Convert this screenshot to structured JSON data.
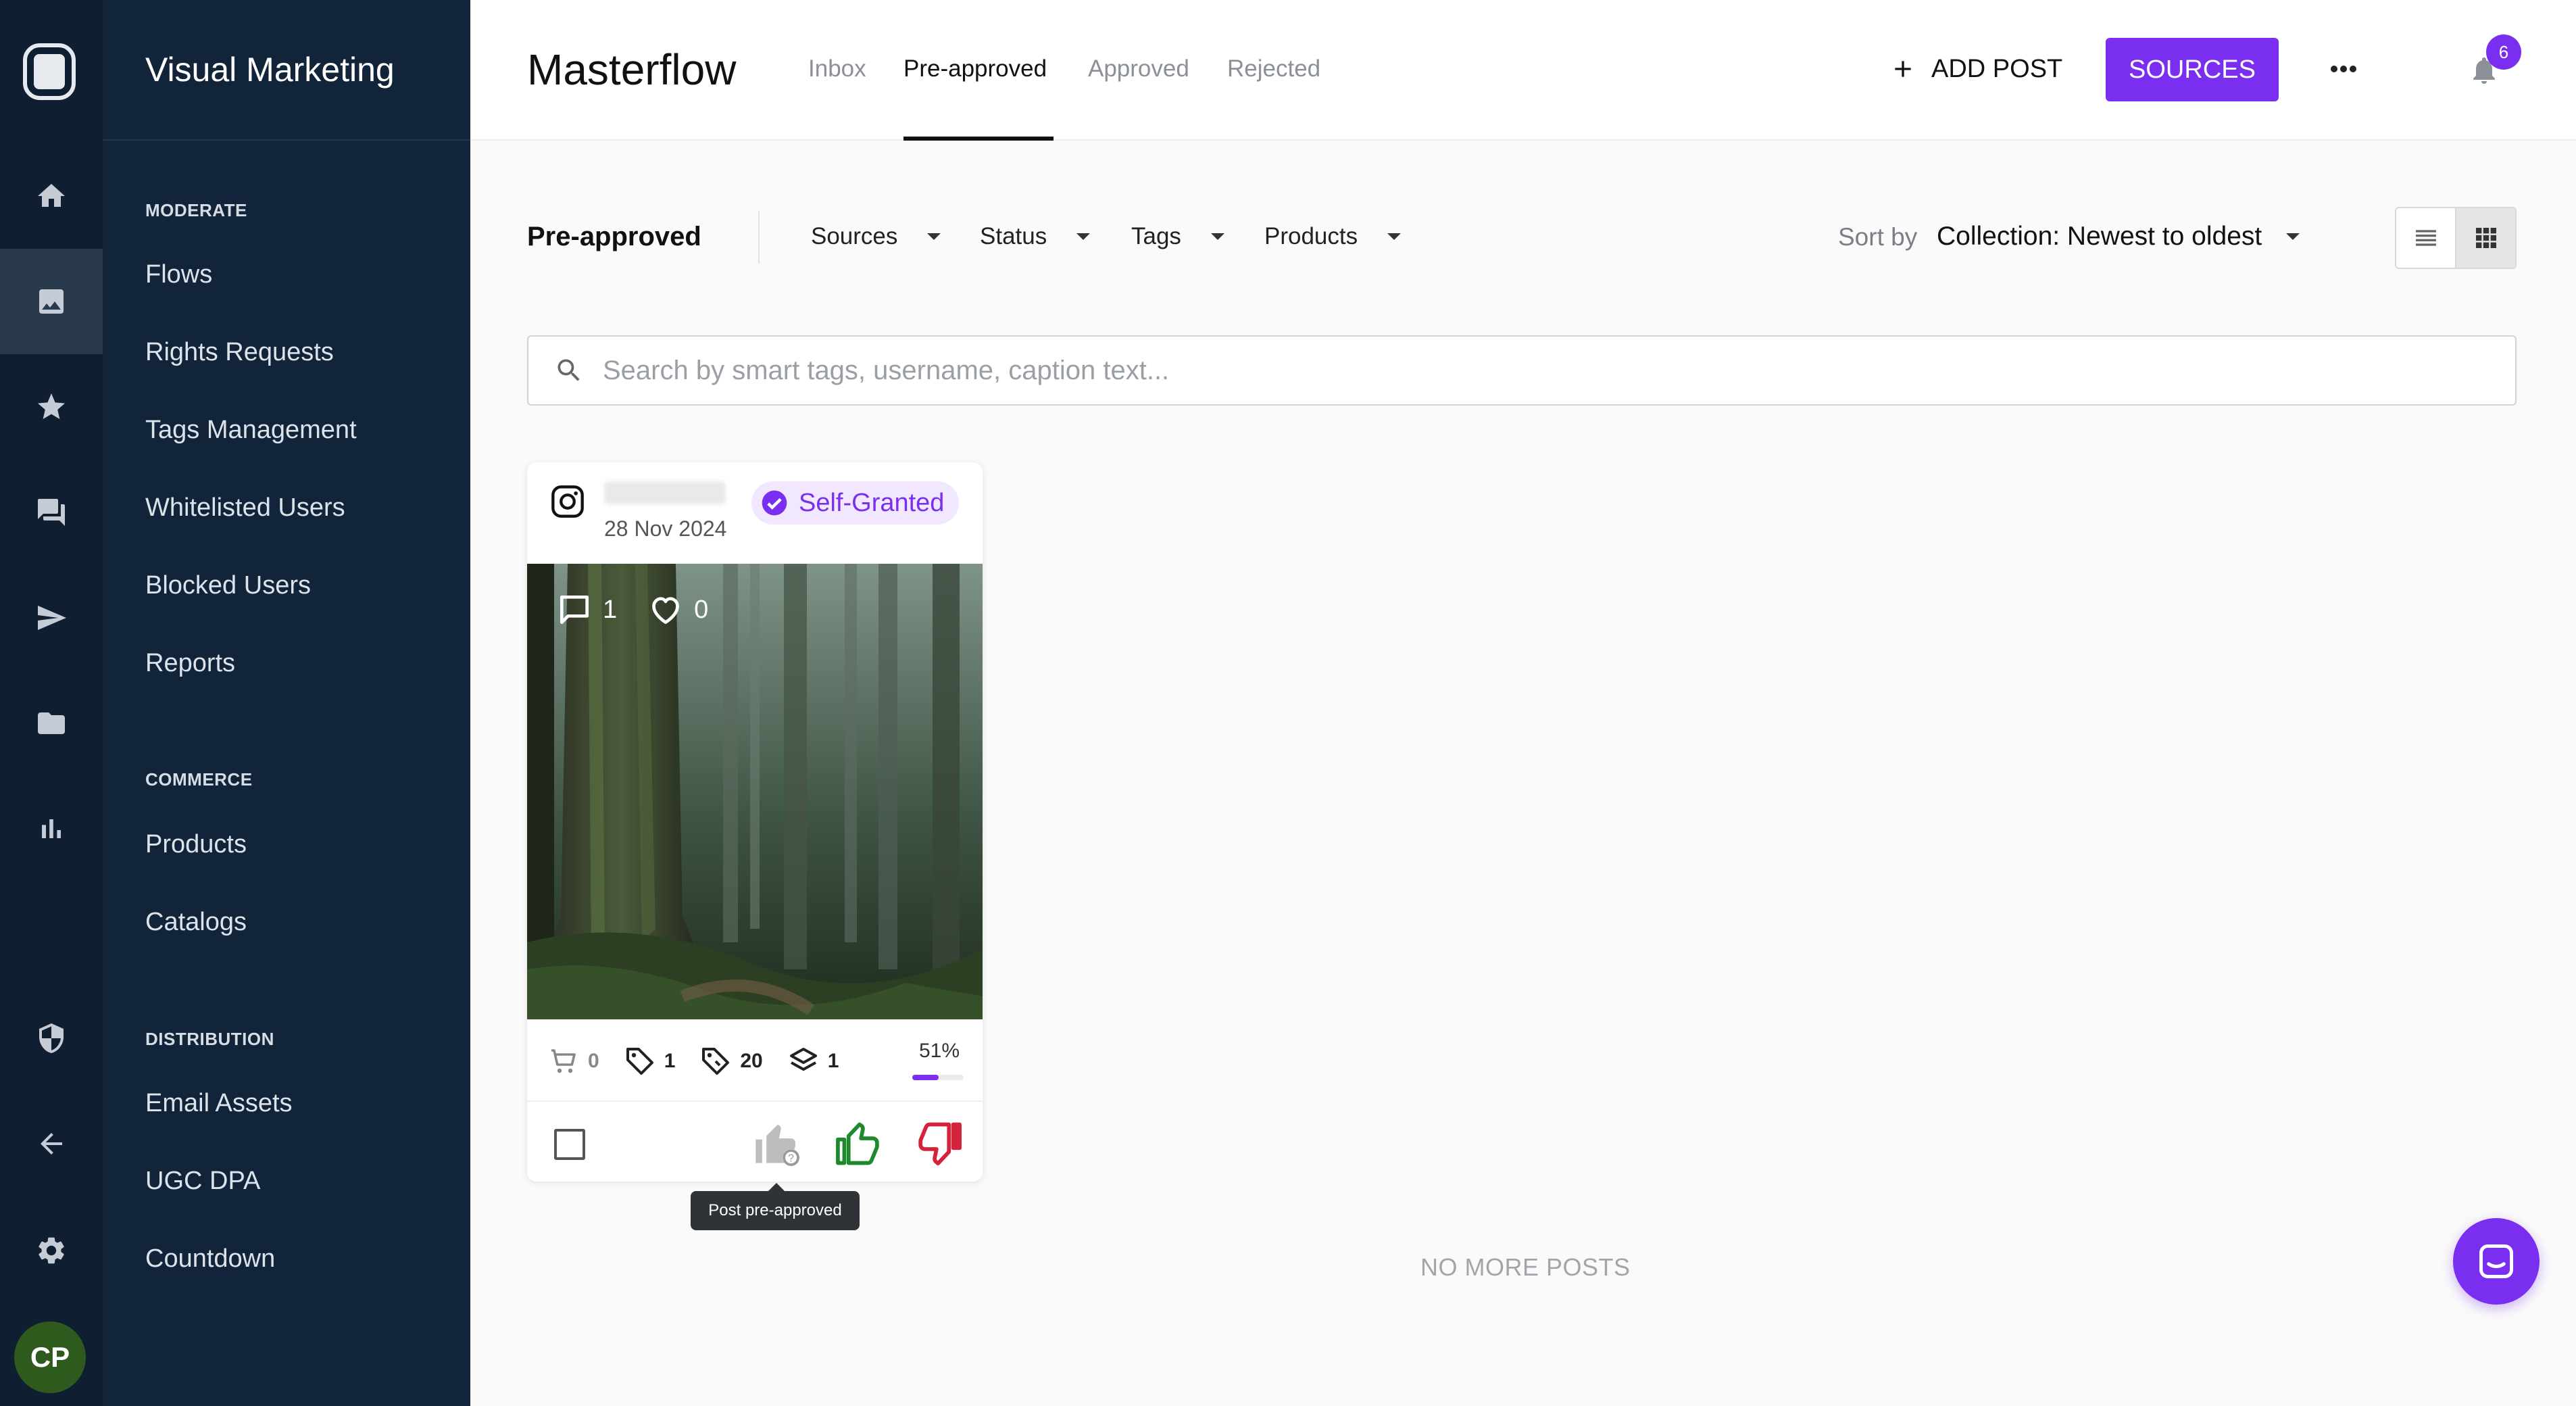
{
  "app": {
    "name": "Visual Marketing",
    "avatar_initials": "CP",
    "accent_color": "#7a2ff0"
  },
  "rail": {
    "icons": [
      "home-icon",
      "image-icon",
      "star-icon",
      "chat-icon",
      "send-icon",
      "folder-icon",
      "bar-chart-icon",
      "shield-icon",
      "back-arrow-icon",
      "gear-icon"
    ],
    "active": "image-icon"
  },
  "nav": {
    "sections": [
      {
        "title": "MODERATE",
        "items": [
          "Flows",
          "Rights Requests",
          "Tags Management",
          "Whitelisted Users",
          "Blocked Users",
          "Reports"
        ]
      },
      {
        "title": "COMMERCE",
        "items": [
          "Products",
          "Catalogs"
        ]
      },
      {
        "title": "DISTRIBUTION",
        "items": [
          "Email Assets",
          "UGC DPA",
          "Countdown"
        ]
      }
    ]
  },
  "header": {
    "title": "Masterflow",
    "tabs": [
      {
        "label": "Inbox",
        "active": false
      },
      {
        "label": "Pre-approved",
        "active": true
      },
      {
        "label": "Approved",
        "active": false
      },
      {
        "label": "Rejected",
        "active": false
      }
    ],
    "add_post_label": "ADD POST",
    "sources_label": "SOURCES",
    "notification_count": "6"
  },
  "filters": {
    "current_view": "Pre-approved",
    "dropdowns": [
      "Sources",
      "Status",
      "Tags",
      "Products"
    ],
    "sort_label": "Sort by",
    "sort_value": "Collection: Newest to oldest",
    "view_mode": "grid"
  },
  "search": {
    "placeholder": "Search by smart tags, username, caption text..."
  },
  "posts": [
    {
      "source": "instagram-icon",
      "date": "28 Nov 2024",
      "rights_badge": "Self-Granted",
      "comments": "1",
      "likes": "0",
      "products": "0",
      "tags": "1",
      "smart_tags": "20",
      "layers": "1",
      "score": "51%",
      "score_fraction": 0.51,
      "tooltip": "Post pre-approved"
    }
  ],
  "footer": {
    "no_more_posts": "NO MORE POSTS"
  }
}
